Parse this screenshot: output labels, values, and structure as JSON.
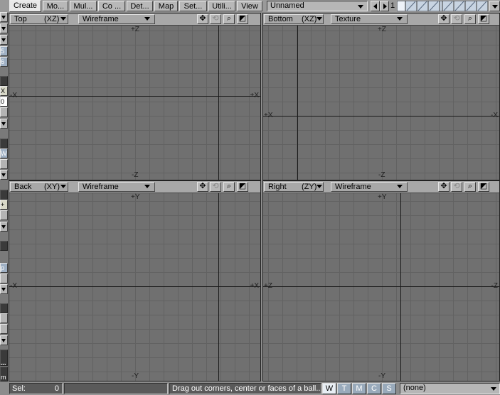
{
  "menu_tabs": [
    "Create",
    "Mo...",
    "Mul...",
    "Co ...",
    "Det...",
    "Map",
    "Set...",
    "Utili...",
    "View"
  ],
  "active_tab": "Create",
  "object_dropdown": "Unnamed",
  "layer_number": "1",
  "left_strip_labels": [
    "5",
    "6",
    "X",
    "0",
    "W",
    "+",
    "p",
    "m",
    "m"
  ],
  "viewports": [
    {
      "view": "Top",
      "axes": "(XZ)",
      "mode": "Wireframe",
      "labels": {
        "top": "+Z",
        "bottom": "-Z",
        "left": "-X",
        "right": "+X"
      }
    },
    {
      "view": "Bottom",
      "axes": "(XZ)",
      "mode": "Texture",
      "labels": {
        "top": "+Z",
        "bottom": "-Z",
        "left": "+X",
        "right": "-X"
      }
    },
    {
      "view": "Back",
      "axes": "(XY)",
      "mode": "Wireframe",
      "labels": {
        "top": "+Y",
        "bottom": "-Y",
        "left": "-X",
        "right": "+X"
      }
    },
    {
      "view": "Right",
      "axes": "(ZY)",
      "mode": "Wireframe",
      "labels": {
        "top": "+Y",
        "bottom": "-Y",
        "left": "+Z",
        "right": "-Z"
      }
    }
  ],
  "status": {
    "sel_label": "Sel:",
    "sel_value": "0",
    "message": "Drag out corners, center or faces of a ball...",
    "mode_buttons": [
      "W",
      "T",
      "M",
      "C",
      "S"
    ],
    "active_mode": "W",
    "surface_dropdown": "(none)"
  },
  "colors": {
    "canvas": "#707070",
    "grid_line": "#626262",
    "axis_line": "#1a1a1a",
    "header": "#a8a8a8"
  }
}
